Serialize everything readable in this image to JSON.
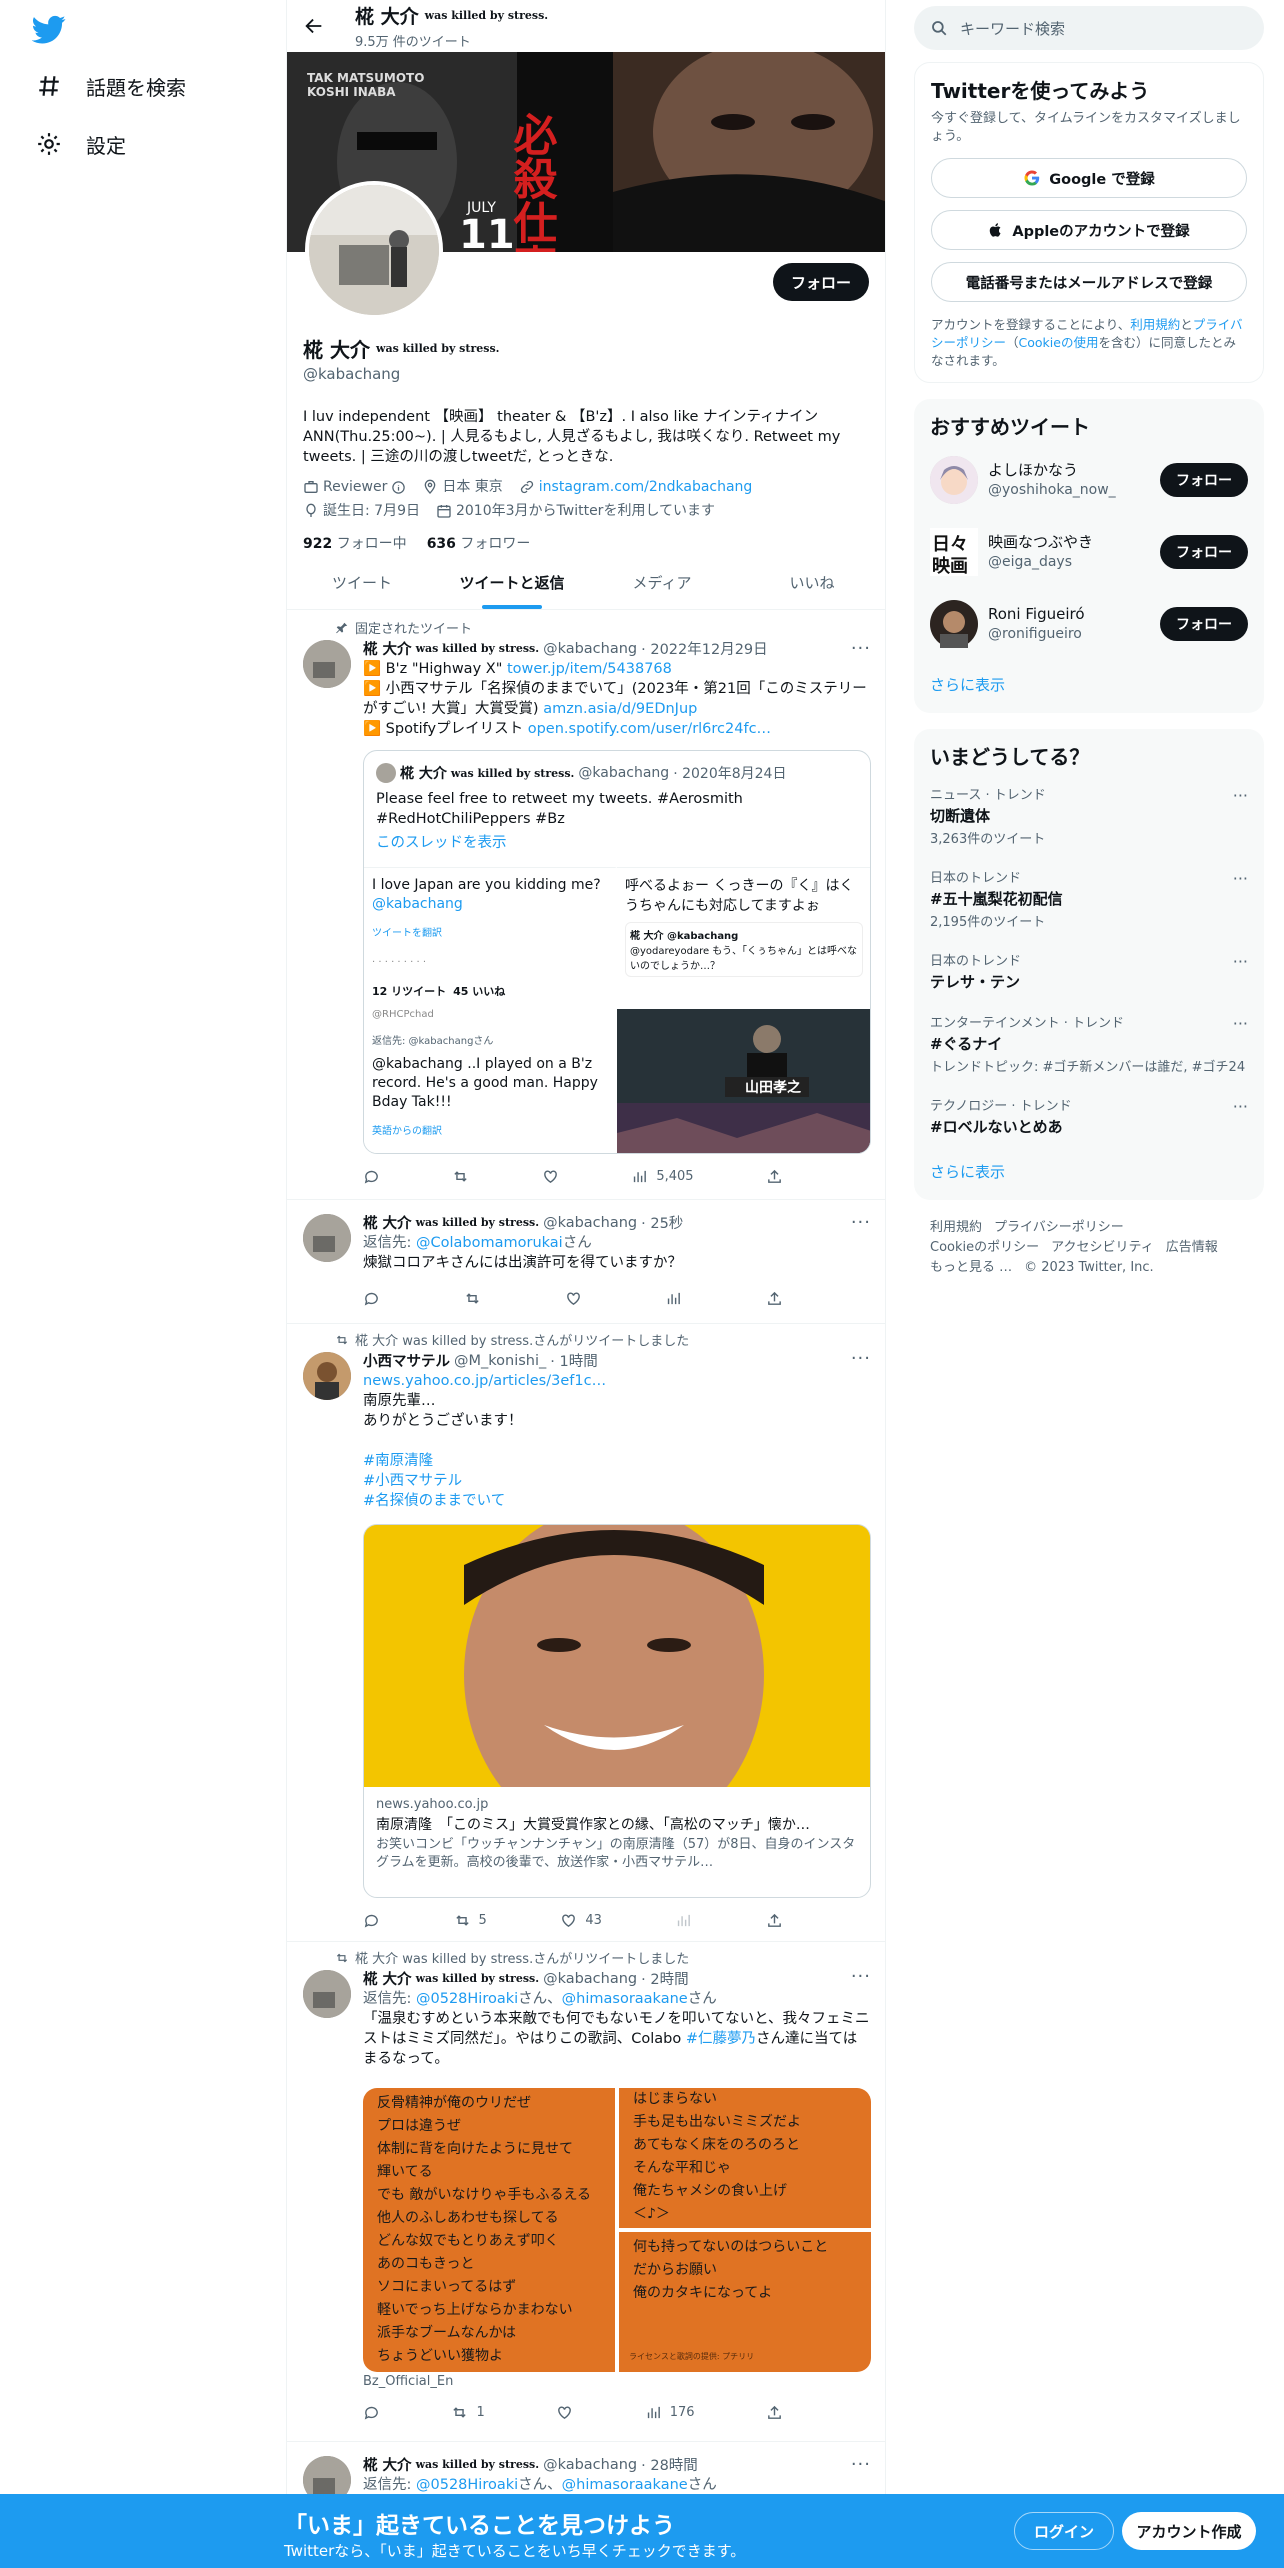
{
  "nav": {
    "explore": "話題を検索",
    "settings": "設定"
  },
  "header": {
    "name": "椛 大介",
    "name_suffix": "was killed by stress.",
    "tweet_count": "9.5万 件のツイート"
  },
  "banner": {
    "left_text1": "TAK MATSUMOTO",
    "left_text2": "KOSHI INABA",
    "month": "JULY",
    "day": "11",
    "kanji": "必殺仕事人"
  },
  "profile": {
    "follow_label": "フォロー",
    "name": "椛 大介",
    "name_suffix": "was killed by stress.",
    "handle": "@kabachang",
    "bio": "I luv independent 【映画】 theater & 【B'z】. I also like ナインティナイン ANN(Thu.25:00~). | 人見るもよし, 人見ざるもよし, 我は咲くなり. Retweet my tweets. | 三途の川の渡しtweetだ, とっときな.",
    "job": "Reviewer",
    "location": "日本 東京",
    "link": "instagram.com/2ndkabachang",
    "birthday": "誕生日: 7月9日",
    "joined": "2010年3月からTwitterを利用しています",
    "following_count": "922",
    "following_label": "フォロー中",
    "followers_count": "636",
    "followers_label": "フォロワー"
  },
  "tabs": [
    "ツイート",
    "ツイートと返信",
    "メディア",
    "いいね"
  ],
  "tweets": {
    "t1": {
      "pinned": "固定されたツイート",
      "name": "椛 大介",
      "suffix": "was killed by stress.",
      "handle": "@kabachang",
      "date": "· 2022年12月29日",
      "l1a": "B'z \"Highway X\"",
      "l1b": "tower.jp/item/5438768",
      "l2a": "小西マサテル「名探偵のままでいて」(2023年・第21回「このミステリーがすごい! 大賞」大賞受賞)",
      "l2b": "amzn.asia/d/9EDnJup",
      "l3a": "Spotifyプレイリスト",
      "l3b": "open.spotify.com/user/rl6rc24fc…",
      "quote": {
        "name": "椛 大介",
        "suffix": "was killed by stress.",
        "handle": "@kabachang",
        "date": "· 2020年8月24日",
        "text1": "Please feel free to retweet my tweets. #Aerosmith",
        "text2": "#RedHotChiliPeppers #Bz",
        "thread": "このスレッドを表示",
        "m1": "I love Japan are you kidding me?",
        "m1b": "@kabachang",
        "m1c": "ツイートを翻訳",
        "m1d": "12 リツイート",
        "m1e": "45 いいね",
        "m1f": "@RHCPchad",
        "m1g": "返信先: @kabachangさん",
        "m1h": "@kabachang ..I played on a B'z record. He's a good man. Happy Bday Tak!!!",
        "m1i": "英語からの翻訳",
        "m2": "呼べるよぉー くっきーの『く』はくうちゃんにも対応してますよぉ",
        "m2b": "椛 大介 @kabachang",
        "m2c": "@yodareyodare もう、「くぅちゃん」とは呼べないのでしょうか…？",
        "m3": "山田孝之"
      },
      "views": "5,405"
    },
    "t2": {
      "name": "椛 大介",
      "suffix": "was killed by stress.",
      "handle": "@kabachang",
      "date": "· 25秒",
      "reply_label": "返信先:",
      "reply_to": "@Colabomamorukai",
      "reply_san": "さん",
      "text": "煉獄コロアキさんには出演許可を得ていますか？"
    },
    "t3": {
      "ctx": "椛 大介 was killed by stress.さんがリツイートしました",
      "name": "小西マサテル",
      "handle": "@M_konishi_",
      "date": "· 1時間",
      "link": "news.yahoo.co.jp/articles/3ef1c…",
      "text1": "南原先輩…",
      "text2": "ありがとうございます！",
      "tag1": "#南原清隆",
      "tag2": "#小西マサテル",
      "tag3": "#名探偵のままでいて",
      "card_domain": "news.yahoo.co.jp",
      "card_title": "南原清隆　「このミス」大賞受賞作家との縁、「高松のマッチ」懐か…",
      "card_desc": "お笑いコンビ「ウッチャンナンチャン」の南原清隆（57）が8日、自身のインスタグラムを更新。高校の後輩で、放送作家・小西マサテル…",
      "retweets": "5",
      "likes": "43"
    },
    "t4": {
      "ctx": "椛 大介 was killed by stress.さんがリツイートしました",
      "name": "椛 大介",
      "suffix": "was killed by stress.",
      "handle": "@kabachang",
      "date": "· 2時間",
      "reply_label": "返信先:",
      "reply_to1": "@0528Hiroaki",
      "reply_mid": "さん、",
      "reply_to2": "@himasoraakane",
      "reply_san": "さん",
      "text": "「温泉むすめという本来敵でも何でもないモノを叩いてないと、我々フェミニストはミミズ同然だ」。やはりこの歌詞、Colabo",
      "tag": "#仁藤夢乃",
      "text_end": "さん達に当てはまるなって。",
      "lyrics_left": [
        "反骨精神が俺のウリだぜ",
        "プロは違うぜ",
        "体制に背を向けたように見せて",
        "輝いてる",
        "でも 敵がいなけりゃ手もふるえる",
        "他人のふしあわせも探してる",
        "どんな奴でもとりあえず叩く",
        "あのコもきっと",
        "ソコにまいってるはず",
        "軽いでっち上げならかまわない",
        "派手なブームなんかは",
        "ちょうどいい獲物よ"
      ],
      "lyrics_r1": [
        "はじまらない",
        "手も足も出ないミミズだよ",
        "あてもなく床をのろのろと",
        "そんな平和じゃ",
        "俺たちャメシの食い上げ",
        "＜♪＞"
      ],
      "lyrics_r2": [
        "何も持ってないのはつらいこと",
        "だからお願い",
        "俺のカタキになってよ"
      ],
      "lyrics_credit": "ライセンスと歌詞の提供: プチリリ",
      "source": "Bz_Official_En",
      "retweets": "1",
      "views": "176"
    },
    "t5": {
      "name": "椛 大介",
      "suffix": "was killed by stress.",
      "handle": "@kabachang",
      "date": "· 28時間",
      "reply_label": "返信先:",
      "reply_to1": "@0528Hiroaki",
      "reply_mid": "さん、",
      "reply_to2": "@himasoraakane",
      "reply_san": "さん"
    }
  },
  "right": {
    "search_placeholder": "キーワード検索",
    "signup_title": "Twitterを使ってみよう",
    "signup_sub": "今すぐ登録して、タイムラインをカスタマイズしましょう。",
    "google": "Google で登録",
    "apple": "Appleのアカウントで登録",
    "phone": "電話番号またはメールアドレスで登録",
    "terms_a": "アカウントを登録することにより、",
    "terms_b": "利用規約",
    "terms_c": "と",
    "terms_d": "プライバシーポリシー",
    "terms_e": "（",
    "terms_f": "Cookieの使用",
    "terms_g": "を含む）に同意したとみなされます。",
    "rec_title": "おすすめツイート",
    "recs": [
      {
        "name": "よしほかなう",
        "handle": "@yoshihoka_now_"
      },
      {
        "name": "映画なつぶやき",
        "handle": "@eiga_days"
      },
      {
        "name": "Roni Figueiró",
        "handle": "@ronifigueiro"
      }
    ],
    "rec_follow": "フォロー",
    "show_more": "さらに表示",
    "trends_title": "いまどうしてる？",
    "trends": [
      {
        "cat": "ニュース · トレンド",
        "name": "切断遺体",
        "count": "3,263件のツイート"
      },
      {
        "cat": "日本のトレンド",
        "name": "#五十嵐梨花初配信",
        "count": "2,195件のツイート"
      },
      {
        "cat": "日本のトレンド",
        "name": "テレサ・テン",
        "count": ""
      },
      {
        "cat": "エンターテインメント · トレンド",
        "name": "#ぐるナイ",
        "count": "トレンドトピック: #ゴチ新メンバーは誰だ, #ゴチ24"
      },
      {
        "cat": "テクノロジー · トレンド",
        "name": "#ロベルないとめあ",
        "count": ""
      }
    ],
    "footer1": [
      "利用規約",
      "プライバシーポリシー"
    ],
    "footer2": [
      "Cookieのポリシー",
      "アクセシビリティ",
      "広告情報"
    ],
    "footer3": [
      "もっと見る …",
      "© 2023 Twitter, Inc."
    ]
  },
  "bottom": {
    "title": "「いま」起きていることを見つけよう",
    "sub": "Twitterなら、「いま」起きていることをいち早くチェックできます。",
    "login": "ログイン",
    "signup": "アカウント作成"
  },
  "colors": {
    "accent": "#1d9bf0",
    "text": "#0f1419",
    "muted": "#536471",
    "lyrics_bg": "#e07323"
  }
}
